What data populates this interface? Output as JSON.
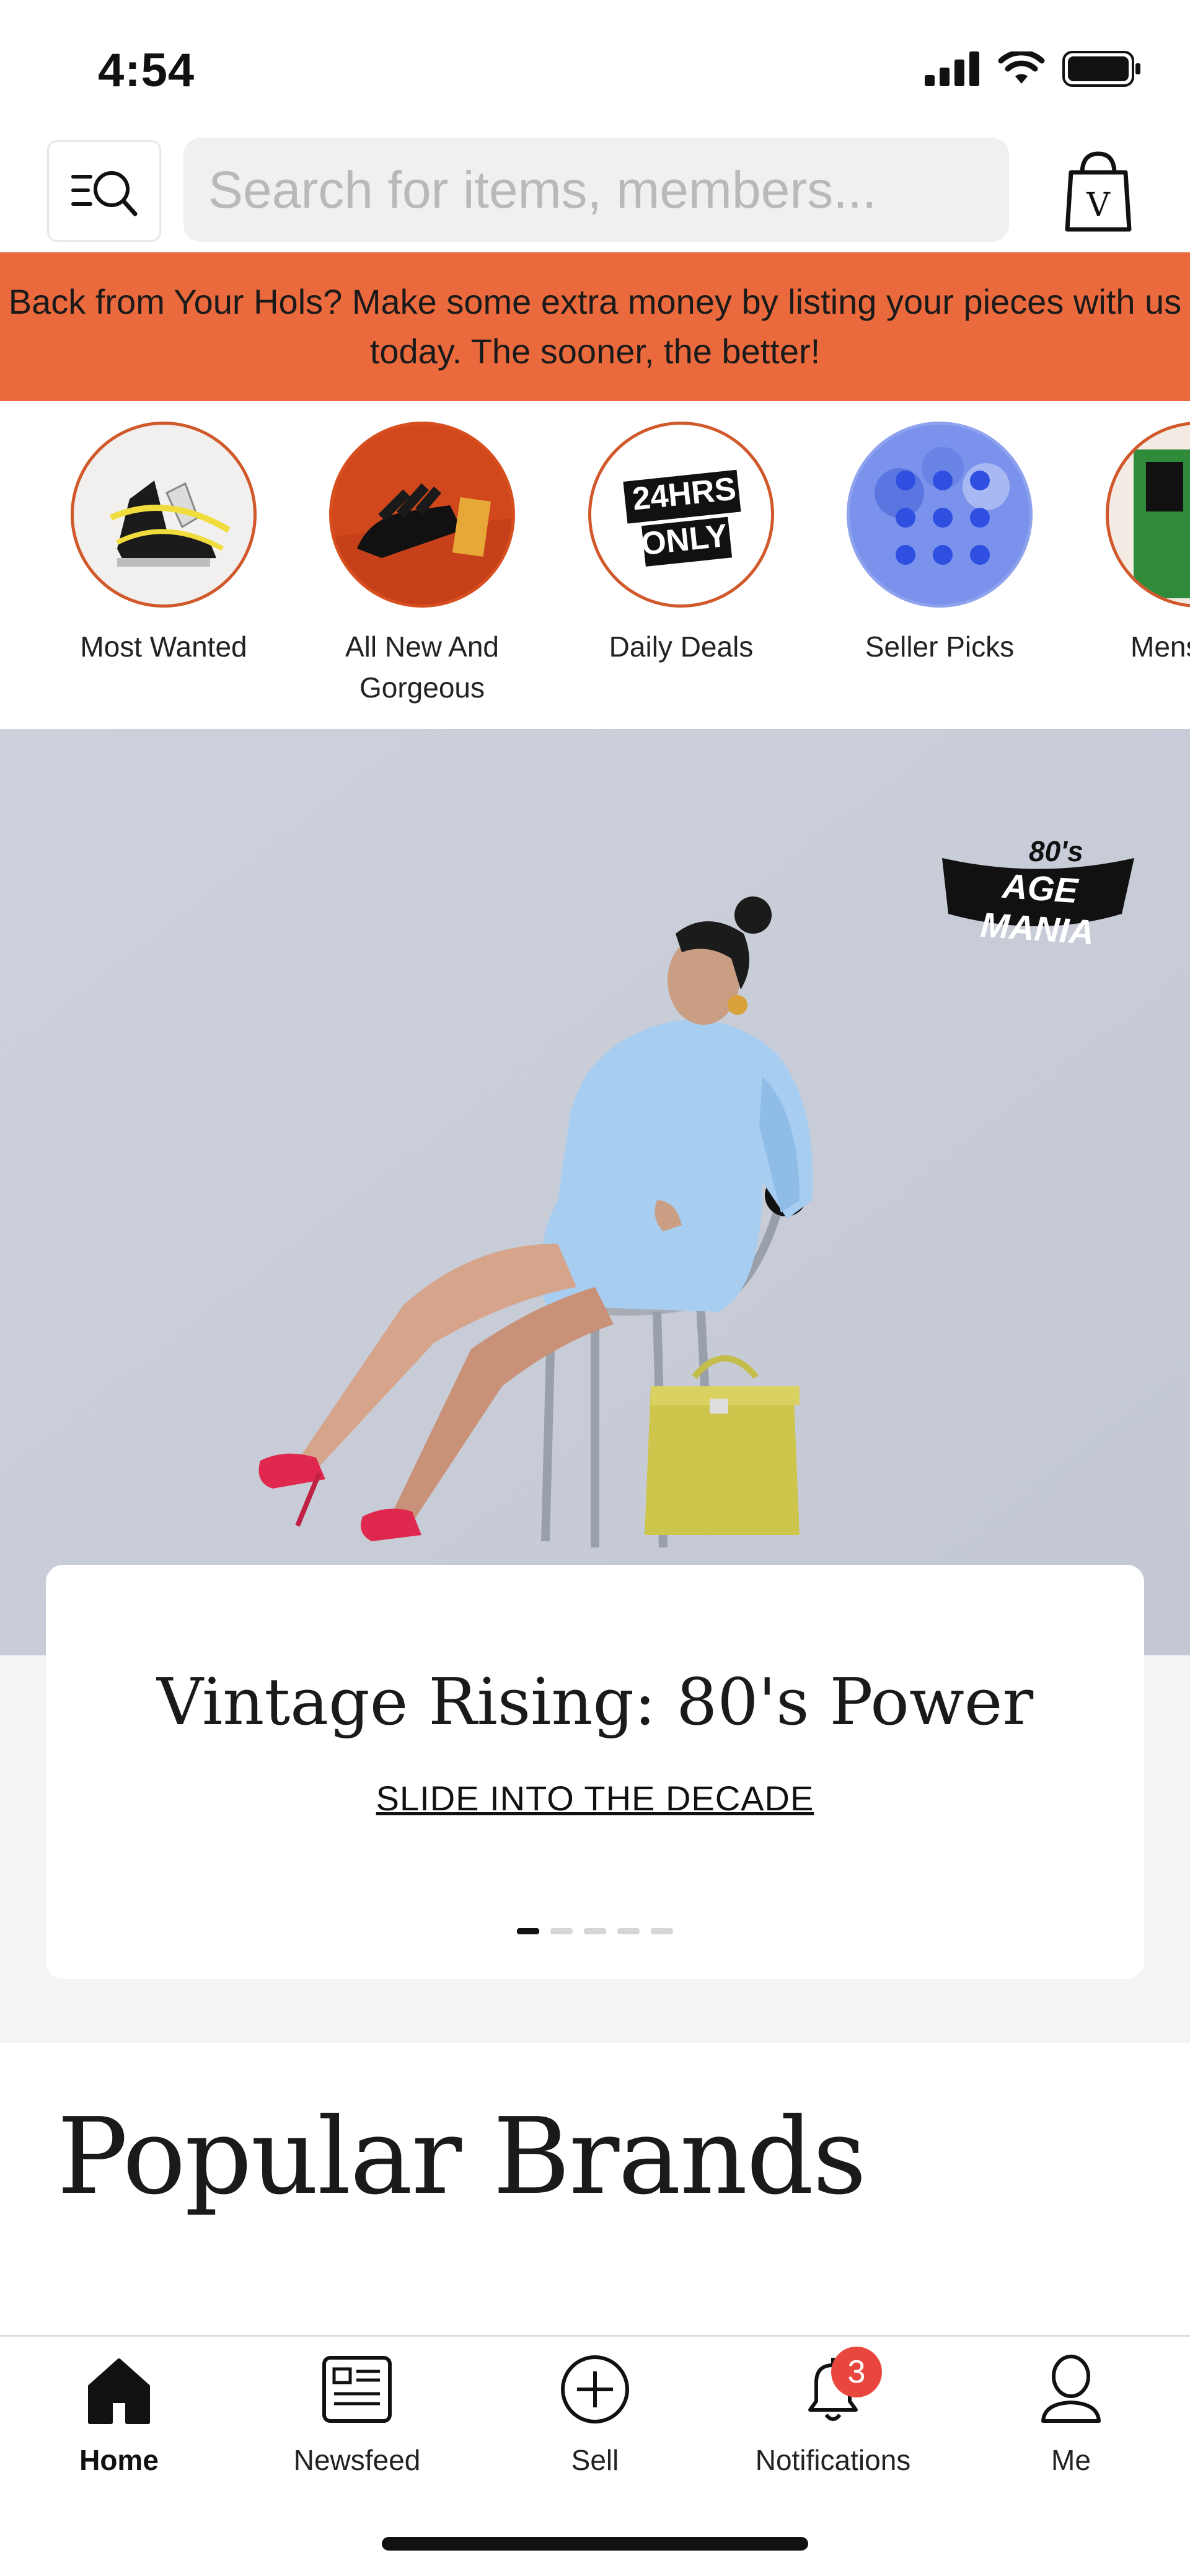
{
  "status_bar": {
    "time": "4:54"
  },
  "header": {
    "search_placeholder": "Search for items, members..."
  },
  "promo_banner": {
    "text": "Back from Your Hols? Make some extra money by listing your pieces with us today. The sooner, the better!",
    "color": "#ea6a3d"
  },
  "categories": [
    {
      "label": "Most Wanted"
    },
    {
      "label": "All New And Gorgeous"
    },
    {
      "label": "Daily Deals",
      "badge_line1": "24HRS",
      "badge_line2": "ONLY"
    },
    {
      "label": "Seller Picks"
    },
    {
      "label": "Mens"
    }
  ],
  "hero": {
    "logo_text": "AGE MANIA",
    "logo_subtext": "80's",
    "title": "Vintage Rising: 80's Power",
    "link": "SLIDE INTO THE DECADE",
    "slide_count": 5,
    "active_slide": 1
  },
  "popular_brands": {
    "title": "Popular Brands"
  },
  "tab_bar": {
    "tabs": [
      {
        "label": "Home",
        "icon": "home-icon",
        "active": true
      },
      {
        "label": "Newsfeed",
        "icon": "newsfeed-icon"
      },
      {
        "label": "Sell",
        "icon": "plus-circle-icon"
      },
      {
        "label": "Notifications",
        "icon": "bell-icon",
        "badge": "3"
      },
      {
        "label": "Me",
        "icon": "person-icon"
      }
    ]
  }
}
